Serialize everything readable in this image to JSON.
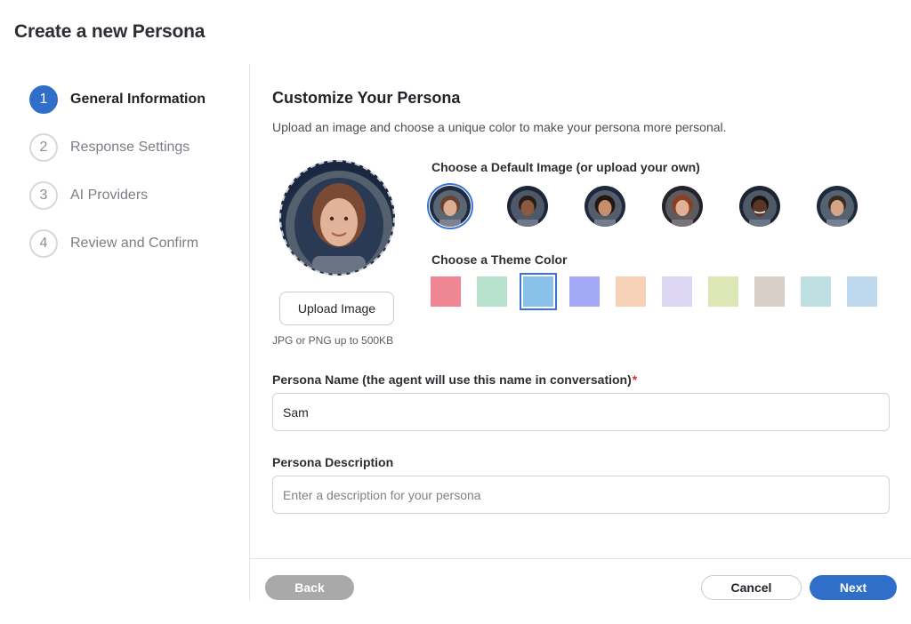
{
  "page": {
    "title": "Create a new Persona"
  },
  "steps": [
    {
      "number": "1",
      "label": "General Information",
      "active": true
    },
    {
      "number": "2",
      "label": "Response Settings",
      "active": false
    },
    {
      "number": "3",
      "label": "AI Providers",
      "active": false
    },
    {
      "number": "4",
      "label": "Review and Confirm",
      "active": false
    }
  ],
  "customize": {
    "title": "Customize Your Persona",
    "subtitle": "Upload an image and choose a unique color to make your persona more personal.",
    "upload_label": "Upload Image",
    "upload_hint": "JPG or PNG up to 500KB",
    "default_image_label": "Choose a Default Image (or upload your own)",
    "theme_color_label": "Choose a Theme Color",
    "default_images": [
      {
        "icon": "astronaut-woman-1",
        "selected": true
      },
      {
        "icon": "astronaut-man-1",
        "selected": false
      },
      {
        "icon": "astronaut-woman-2",
        "selected": false
      },
      {
        "icon": "astronaut-woman-3",
        "selected": false
      },
      {
        "icon": "astronaut-man-2",
        "selected": false
      },
      {
        "icon": "astronaut-man-3",
        "selected": false
      }
    ],
    "theme_colors": [
      {
        "color": "#EE8693",
        "selected": false
      },
      {
        "color": "#B7E0CD",
        "selected": false
      },
      {
        "color": "#88C2EB",
        "selected": true
      },
      {
        "color": "#A4A9F6",
        "selected": false
      },
      {
        "color": "#F7D2B8",
        "selected": false
      },
      {
        "color": "#DCD6F2",
        "selected": false
      },
      {
        "color": "#DDE7B5",
        "selected": false
      },
      {
        "color": "#D9CFC9",
        "selected": false
      },
      {
        "color": "#BEE0E3",
        "selected": false
      },
      {
        "color": "#BDD7EC",
        "selected": false
      }
    ]
  },
  "form": {
    "name_label": "Persona Name (the agent will use this name in conversation)",
    "name_required_mark": "*",
    "name_value": "Sam",
    "description_label": "Persona Description",
    "description_value": "",
    "description_placeholder": "Enter a description for your persona"
  },
  "footer": {
    "back_label": "Back",
    "cancel_label": "Cancel",
    "next_label": "Next"
  },
  "colors": {
    "primary": "#2F6FC9",
    "disabled": "#A9A9A9",
    "required": "#D0312D"
  }
}
